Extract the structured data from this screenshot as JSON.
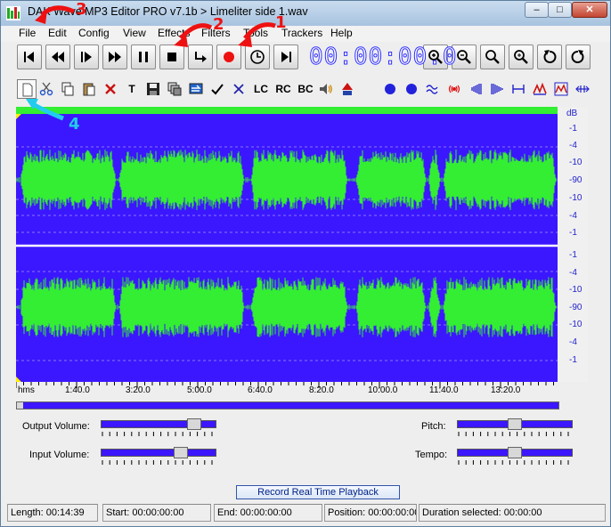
{
  "window": {
    "title": "DAK Wave MP3 Editor PRO v7.1b > Limeliter side 1.wav",
    "controls": {
      "minimize": "–",
      "maximize": "□",
      "close": "✕"
    }
  },
  "menu": [
    "File",
    "Edit",
    "Config",
    "View",
    "Effects",
    "Filters",
    "Tools",
    "Trackers",
    "Help"
  ],
  "transport": {
    "buttons": [
      {
        "name": "skip-to-start-icon"
      },
      {
        "name": "rewind-icon"
      },
      {
        "name": "play-icon"
      },
      {
        "name": "fast-forward-icon"
      },
      {
        "name": "pause-icon"
      },
      {
        "name": "stop-icon"
      },
      {
        "name": "loop-play-icon"
      },
      {
        "name": "record-icon"
      },
      {
        "name": "timer-icon"
      },
      {
        "name": "skip-to-end-icon"
      }
    ],
    "timecode": "00:00:00.0",
    "zoom_buttons": [
      {
        "name": "zoom-in-icon"
      },
      {
        "name": "zoom-out-icon"
      },
      {
        "name": "zoom-fit-icon"
      },
      {
        "name": "zoom-selection-icon"
      },
      {
        "name": "undo-icon"
      },
      {
        "name": "redo-icon"
      }
    ]
  },
  "edit_toolbar": {
    "buttons": [
      {
        "name": "new-file-icon",
        "label": ""
      },
      {
        "name": "cut-icon",
        "label": ""
      },
      {
        "name": "copy-icon",
        "label": ""
      },
      {
        "name": "paste-icon",
        "label": ""
      },
      {
        "name": "delete-icon",
        "label": ""
      },
      {
        "name": "trim-icon",
        "label": "T"
      },
      {
        "name": "save-icon",
        "label": ""
      },
      {
        "name": "paste-mix-icon",
        "label": ""
      },
      {
        "name": "convert-icon",
        "label": ""
      },
      {
        "name": "check-icon",
        "label": ""
      },
      {
        "name": "crossfade-icon",
        "label": ""
      },
      {
        "name": "lc-button",
        "label": "LC"
      },
      {
        "name": "rc-button",
        "label": "RC"
      },
      {
        "name": "bc-button",
        "label": "BC"
      },
      {
        "name": "volume-icon",
        "label": ""
      },
      {
        "name": "amplify-icon",
        "label": ""
      }
    ],
    "effect_buttons": [
      {
        "name": "left-channel-dot-icon"
      },
      {
        "name": "right-channel-dot-icon"
      },
      {
        "name": "wave-icon"
      },
      {
        "name": "broadcast-icon"
      },
      {
        "name": "fade-in-icon"
      },
      {
        "name": "fade-out-icon"
      },
      {
        "name": "silence-icon"
      },
      {
        "name": "normalize-icon"
      },
      {
        "name": "equalizer-icon"
      },
      {
        "name": "reverse-icon"
      }
    ]
  },
  "waveform": {
    "db_labels_top": [
      "dB",
      "-1",
      "-4",
      "-10",
      "-90",
      "-10",
      "-4",
      "-1"
    ],
    "db_labels_bottom": [
      "-1",
      "-4",
      "-10",
      "-90",
      "-10",
      "-4",
      "-1"
    ],
    "timeline": [
      "hms",
      "1:40.0",
      "3:20.0",
      "5:00.0",
      "6:40.0",
      "8:20.0",
      "10:00.0",
      "11:40.0",
      "13:20.0"
    ]
  },
  "sliders": {
    "output_volume": {
      "label": "Output Volume:",
      "level": 0.86
    },
    "input_volume": {
      "label": "Input Volume:",
      "level": 0.72
    },
    "pitch": {
      "label": "Pitch:",
      "level": 0.5
    },
    "tempo": {
      "label": "Tempo:",
      "level": 0.5
    }
  },
  "record_button": "Record Real Time Playback",
  "status": {
    "length": "Length: 00:14:39",
    "start": "Start: 00:00:00:00",
    "end": "End: 00:00:00:00",
    "position": "Position: 00:00:00:00",
    "duration": "Duration selected: 00:00:00"
  },
  "annotations": [
    "1",
    "2",
    "3",
    "4"
  ],
  "colors": {
    "wave_bg": "#3b17ff",
    "wave_fg": "#33ee33",
    "annotation_red": "#ee1111",
    "annotation_cyan": "#22ccee"
  }
}
